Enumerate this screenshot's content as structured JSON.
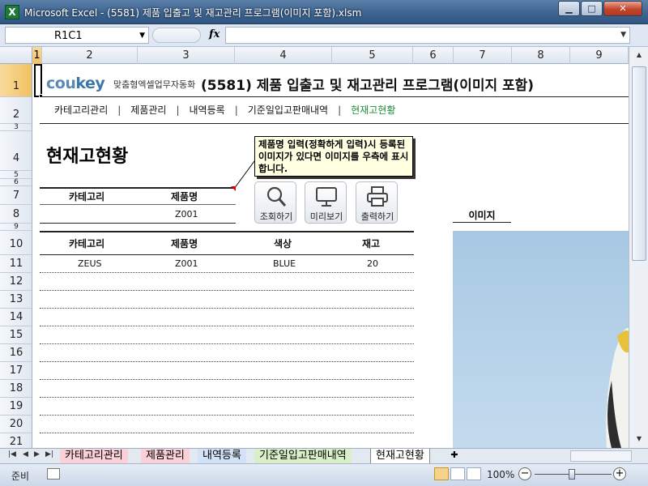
{
  "window": {
    "title": "Microsoft Excel - (5581) 제품 입출고 및 재고관리 프로그램(이미지 포함).xlsm",
    "app_icon_letter": "X",
    "controls": {
      "minimize": "▁",
      "maximize": "□",
      "close": "✕"
    }
  },
  "formula_bar": {
    "name_box": "R1C1",
    "fx_label": "fx",
    "formula": ""
  },
  "columns": [
    "1",
    "2",
    "3",
    "4",
    "5",
    "6",
    "7",
    "8",
    "9"
  ],
  "rows": [
    "1",
    "2",
    "3",
    "4",
    "5",
    "6",
    "7",
    "8",
    "9",
    "10",
    "11",
    "12",
    "13",
    "14",
    "15",
    "16",
    "17",
    "18",
    "19",
    "20",
    "21"
  ],
  "sheet": {
    "logo_main": "cou",
    "logo_key": "key",
    "logo_sub": "맞춤형엑셀업무자동화",
    "title": "(5581) 제품 입출고 및 재고관리 프로그램(이미지 포함)",
    "menu": [
      {
        "label": "카테고리관리",
        "active": false
      },
      {
        "label": "제품관리",
        "active": false
      },
      {
        "label": "내역등록",
        "active": false
      },
      {
        "label": "기준일입고판매내역",
        "active": false
      },
      {
        "label": "현재고현황",
        "active": true
      }
    ],
    "menu_separator": "|",
    "heading": "현재고현황",
    "callout": "제품명 입력(정확하게 입력)시 등록된 이미지가 있다면 이미지를 우측에 표시합니다.",
    "search": {
      "headers": [
        "카테고리",
        "제품명"
      ],
      "values": [
        "",
        "Z001"
      ]
    },
    "buttons": [
      {
        "label": "조회하기",
        "icon": "magnifier-icon"
      },
      {
        "label": "미리보기",
        "icon": "monitor-icon"
      },
      {
        "label": "출력하기",
        "icon": "printer-icon"
      }
    ],
    "image_label": "이미지",
    "results": {
      "headers": [
        "카테고리",
        "제품명",
        "색상",
        "재고"
      ],
      "rows": [
        [
          "ZEUS",
          "Z001",
          "BLUE",
          "20"
        ]
      ]
    }
  },
  "sheet_tabs": [
    "카테고리관리",
    "제품관리",
    "내역등록",
    "기준일입고판매내역",
    "현재고현황"
  ],
  "status": {
    "ready": "준비",
    "zoom": "100%"
  },
  "colors": {
    "title_bar": "#3c6290",
    "active_menu": "#1e8a3a",
    "callout_bg": "#ffffe1"
  }
}
